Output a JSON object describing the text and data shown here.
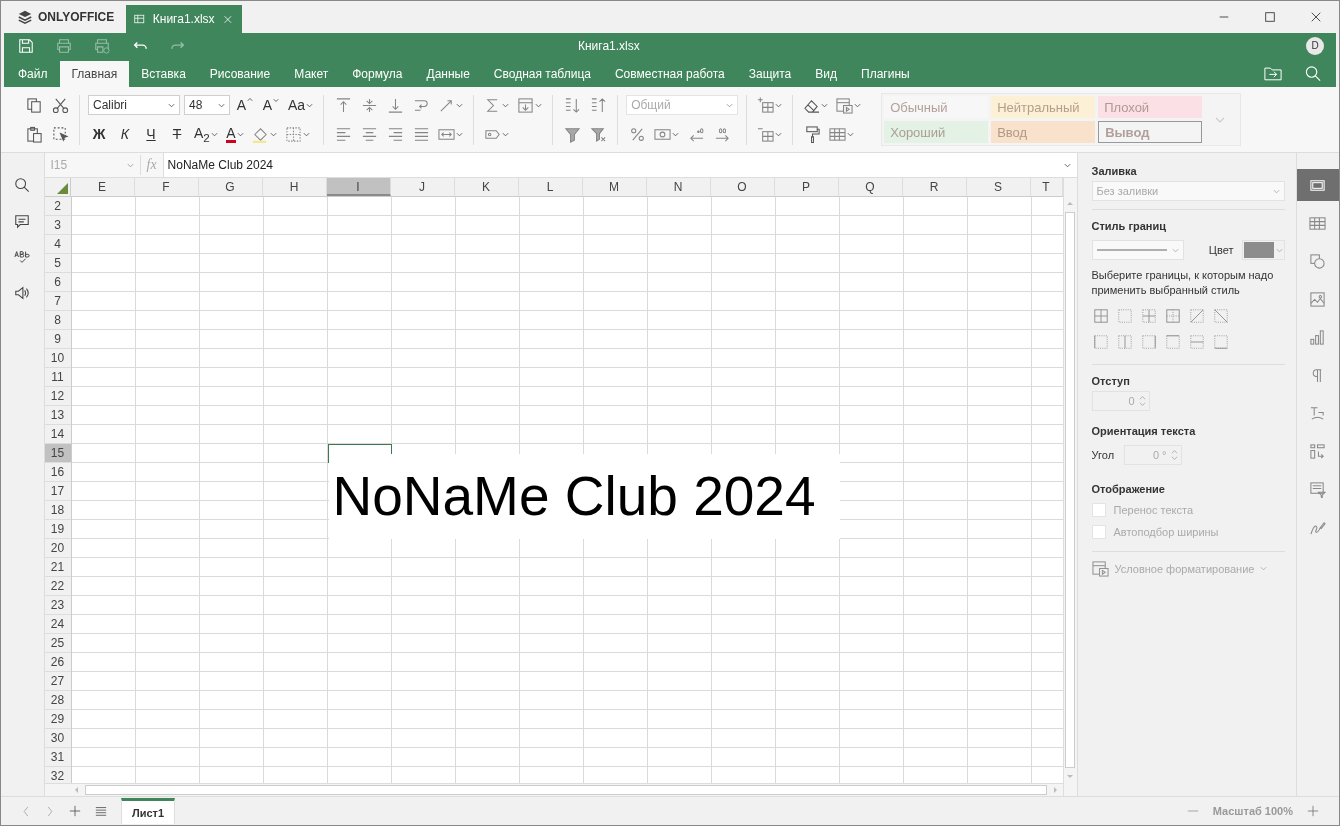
{
  "title_bar": {
    "brand": "ONLYOFFICE",
    "tabs": [
      {
        "label": "Книга1.xlsx",
        "selected": true
      }
    ]
  },
  "header": {
    "title": "Книга1.xlsx",
    "avatar": "D"
  },
  "menu": [
    {
      "label": "Файл",
      "selected": false
    },
    {
      "label": "Главная",
      "selected": true
    },
    {
      "label": "Вставка",
      "selected": false
    },
    {
      "label": "Рисование",
      "selected": false
    },
    {
      "label": "Макет",
      "selected": false
    },
    {
      "label": "Формула",
      "selected": false
    },
    {
      "label": "Данные",
      "selected": false
    },
    {
      "label": "Сводная таблица",
      "selected": false
    },
    {
      "label": "Совместная работа",
      "selected": false
    },
    {
      "label": "Защита",
      "selected": false
    },
    {
      "label": "Вид",
      "selected": false
    },
    {
      "label": "Плагины",
      "selected": false
    }
  ],
  "toolbar": {
    "font_name": "Calibri",
    "font_size": "48",
    "size_buttons": [
      {
        "label": "A",
        "kind": "grow"
      },
      {
        "label": "A",
        "kind": "shrink"
      },
      {
        "label": "Aa",
        "kind": "case"
      }
    ],
    "format_buttons": [
      {
        "label": "Ж",
        "kind": "bold"
      },
      {
        "label": "К",
        "kind": "italic"
      },
      {
        "label": "Ч",
        "kind": "underline"
      },
      {
        "label": "T",
        "kind": "strike"
      },
      {
        "label": "A$_{2}$",
        "kind": "subscript"
      },
      {
        "label": "A",
        "kind": "font-color"
      }
    ],
    "number_format": "Общий",
    "cell_styles": [
      {
        "label": "Обычный",
        "color": "#f7f7f7"
      },
      {
        "label": "Нейтральный",
        "color": "#fcf0d6"
      },
      {
        "label": "Плохой",
        "color": "#fbe1e5"
      },
      {
        "label": "Хороший",
        "color": "#e3f2e5"
      },
      {
        "label": "Ввод",
        "color": "#f9e2cb"
      },
      {
        "label": "Вывод",
        "color": "#f4f4f4"
      }
    ]
  },
  "formula_bar": {
    "cell": "I15",
    "fx": "fx",
    "formula": "NoNaMe Club 2024"
  },
  "sheet": {
    "columns": [
      {
        "label": "E",
        "selected": false
      },
      {
        "label": "F",
        "selected": false
      },
      {
        "label": "G",
        "selected": false
      },
      {
        "label": "H",
        "selected": false
      },
      {
        "label": "I",
        "selected": true
      },
      {
        "label": "J",
        "selected": false
      },
      {
        "label": "K",
        "selected": false
      },
      {
        "label": "L",
        "selected": false
      },
      {
        "label": "M",
        "selected": false
      },
      {
        "label": "N",
        "selected": false
      },
      {
        "label": "O",
        "selected": false
      },
      {
        "label": "P",
        "selected": false
      },
      {
        "label": "Q",
        "selected": false
      },
      {
        "label": "R",
        "selected": false
      },
      {
        "label": "S",
        "selected": false
      },
      {
        "label": "T",
        "selected": false
      }
    ],
    "rows": [
      {
        "label": "2",
        "selected": false
      },
      {
        "label": "3",
        "selected": false
      },
      {
        "label": "4",
        "selected": false
      },
      {
        "label": "5",
        "selected": false
      },
      {
        "label": "6",
        "selected": false
      },
      {
        "label": "7",
        "selected": false
      },
      {
        "label": "8",
        "selected": false
      },
      {
        "label": "9",
        "selected": false
      },
      {
        "label": "10",
        "selected": false
      },
      {
        "label": "11",
        "selected": false
      },
      {
        "label": "12",
        "selected": false
      },
      {
        "label": "13",
        "selected": false
      },
      {
        "label": "14",
        "selected": false
      },
      {
        "label": "15",
        "selected": true
      },
      {
        "label": "16",
        "selected": false
      },
      {
        "label": "17",
        "selected": false
      },
      {
        "label": "18",
        "selected": false
      },
      {
        "label": "19",
        "selected": false
      },
      {
        "label": "20",
        "selected": false
      },
      {
        "label": "21",
        "selected": false
      },
      {
        "label": "22",
        "selected": false
      },
      {
        "label": "23",
        "selected": false
      },
      {
        "label": "24",
        "selected": false
      },
      {
        "label": "25",
        "selected": false
      },
      {
        "label": "26",
        "selected": false
      },
      {
        "label": "27",
        "selected": false
      },
      {
        "label": "28",
        "selected": false
      },
      {
        "label": "29",
        "selected": false
      },
      {
        "label": "30",
        "selected": false
      },
      {
        "label": "31",
        "selected": false
      },
      {
        "label": "32",
        "selected": false
      }
    ],
    "cell_text": "NoNaMe Club 2024"
  },
  "panel": {
    "fill_title": "Заливка",
    "fill_value": "Без заливки",
    "border_title": "Стиль границ",
    "color_label": "Цвет",
    "border_hint": "Выберите границы, к которым надо применить выбранный стиль",
    "indent_title": "Отступ",
    "indent_value": "0",
    "orientation_title": "Ориентация текста",
    "angle_label": "Угол",
    "angle_value": "0 °",
    "display_title": "Отображение",
    "checkboxes": [
      {
        "label": "Перенос текста",
        "checked": false,
        "disabled": true
      },
      {
        "label": "Автоподбор ширины",
        "checked": false,
        "disabled": true
      }
    ],
    "conditional": "Условное форматирование"
  },
  "panel_tabs": [
    {
      "kind": "cell",
      "selected": true
    },
    {
      "kind": "table",
      "selected": false
    },
    {
      "kind": "shape",
      "selected": false
    },
    {
      "kind": "image",
      "selected": false
    },
    {
      "kind": "chart",
      "selected": false
    },
    {
      "kind": "paragraph",
      "selected": false
    },
    {
      "kind": "text-art",
      "selected": false
    },
    {
      "kind": "pivot",
      "selected": false
    },
    {
      "kind": "slicer",
      "selected": false
    },
    {
      "kind": "signature",
      "selected": false
    }
  ],
  "sheet_tabs": [
    {
      "label": "Лист1",
      "selected": true
    }
  ],
  "zoom": "Масштаб 100%"
}
